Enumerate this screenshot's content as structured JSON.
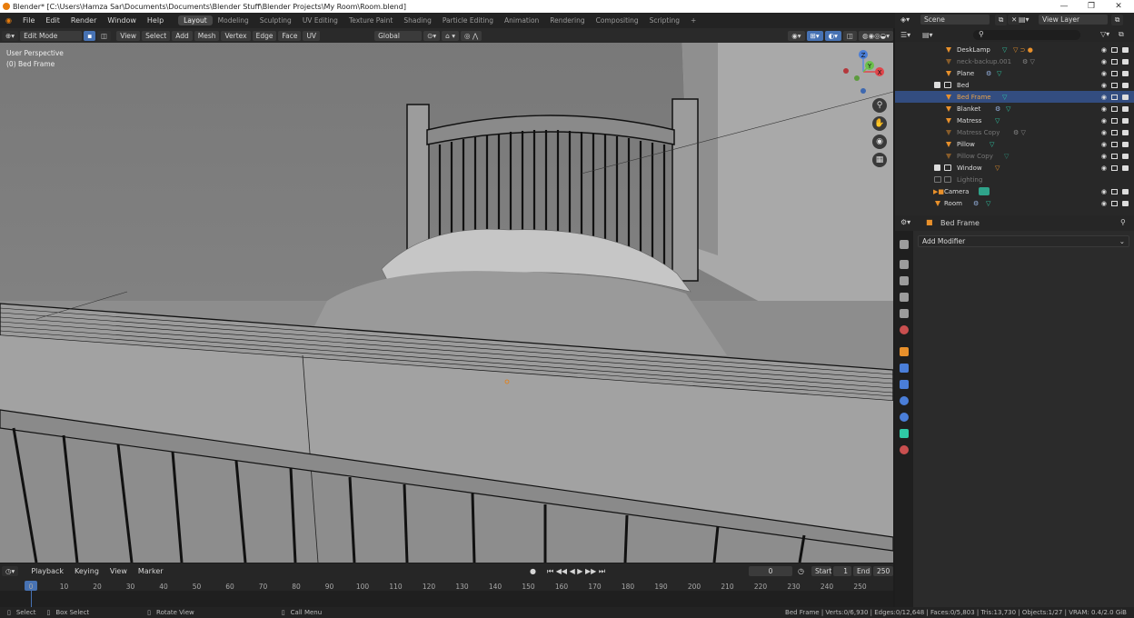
{
  "window": {
    "title": "Blender* [C:\\Users\\Hamza Sar\\Documents\\Documents\\Blender Stuff\\Blender Projects\\My Room\\Room.blend]",
    "minimize": "—",
    "maximize": "❐",
    "close": "✕"
  },
  "menu": [
    "File",
    "Edit",
    "Render",
    "Window",
    "Help"
  ],
  "workspaces": [
    "Layout",
    "Modeling",
    "Sculpting",
    "UV Editing",
    "Texture Paint",
    "Shading",
    "Particle Editing",
    "Animation",
    "Rendering",
    "Compositing",
    "Scripting",
    "+"
  ],
  "scene": {
    "label": "Scene",
    "view_layer": "View Layer"
  },
  "viewport_header": {
    "mode": "Edit Mode",
    "menus": [
      "View",
      "Select",
      "Add",
      "Mesh",
      "Vertex",
      "Edge",
      "Face",
      "UV"
    ],
    "orientation": "Global"
  },
  "viewport": {
    "perspective": "User Perspective",
    "object": "(0) Bed Frame",
    "gizmo": {
      "z": "Z",
      "y": "Y",
      "x": "X"
    }
  },
  "outliner": {
    "search_placeholder": "",
    "rows": [
      {
        "name": "DeskLamp"
      },
      {
        "name": "neck-backup.001"
      },
      {
        "name": "Plane"
      },
      {
        "name": "Bed"
      },
      {
        "name": "Bed Frame"
      },
      {
        "name": "Blanket"
      },
      {
        "name": "Matress"
      },
      {
        "name": "Matress Copy"
      },
      {
        "name": "Pillow"
      },
      {
        "name": "Pillow Copy"
      },
      {
        "name": "Window"
      },
      {
        "name": "Lighting"
      },
      {
        "name": "Camera"
      },
      {
        "name": "Room"
      }
    ]
  },
  "properties": {
    "object": "Bed Frame",
    "add_modifier": "Add Modifier"
  },
  "timeline": {
    "menus": [
      "Playback",
      "Keying",
      "View",
      "Marker"
    ],
    "current_frame": "0",
    "start_label": "Start",
    "start": "1",
    "end_label": "End",
    "end": "250",
    "ticks": [
      "0",
      "10",
      "20",
      "30",
      "40",
      "50",
      "60",
      "70",
      "80",
      "90",
      "100",
      "110",
      "120",
      "130",
      "140",
      "150",
      "160",
      "170",
      "180",
      "190",
      "200",
      "210",
      "220",
      "230",
      "240",
      "250"
    ]
  },
  "statusbar": {
    "select": "Select",
    "box_select": "Box Select",
    "rotate": "Rotate View",
    "call_menu": "Call Menu",
    "stats": "Bed Frame | Verts:0/6,930 | Edges:0/12,648 | Faces:0/5,803 | Tris:13,730 | Objects:1/27 | VRAM: 0.4/2.0 GiB"
  }
}
